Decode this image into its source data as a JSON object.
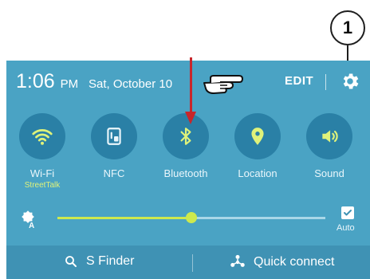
{
  "annotation": {
    "callout_number": "1"
  },
  "status_bar": {
    "time": "1:06",
    "ampm": "PM",
    "date": "Sat, October 10",
    "edit_label": "EDIT",
    "settings_icon": "gear-icon"
  },
  "quick_toggles": [
    {
      "label": "Wi-Fi",
      "sublabel": "StreetTalk",
      "icon": "wifi-icon",
      "active": true
    },
    {
      "label": "NFC",
      "icon": "nfc-icon",
      "active": false
    },
    {
      "label": "Bluetooth",
      "icon": "bluetooth-icon",
      "active": true
    },
    {
      "label": "Location",
      "icon": "location-icon",
      "active": true
    },
    {
      "label": "Sound",
      "icon": "sound-icon",
      "active": true
    }
  ],
  "brightness": {
    "icon": "auto-brightness-icon",
    "level": 0.5,
    "auto_label": "Auto",
    "auto_checked": true
  },
  "bottom_bar": {
    "finder_label": "S Finder",
    "quick_connect_label": "Quick connect"
  },
  "colors": {
    "panel": "#4aa3c4",
    "toggle_circle": "#2a80a6",
    "accent_green": "#cde94e",
    "annotation_arrow": "#c8262b"
  }
}
